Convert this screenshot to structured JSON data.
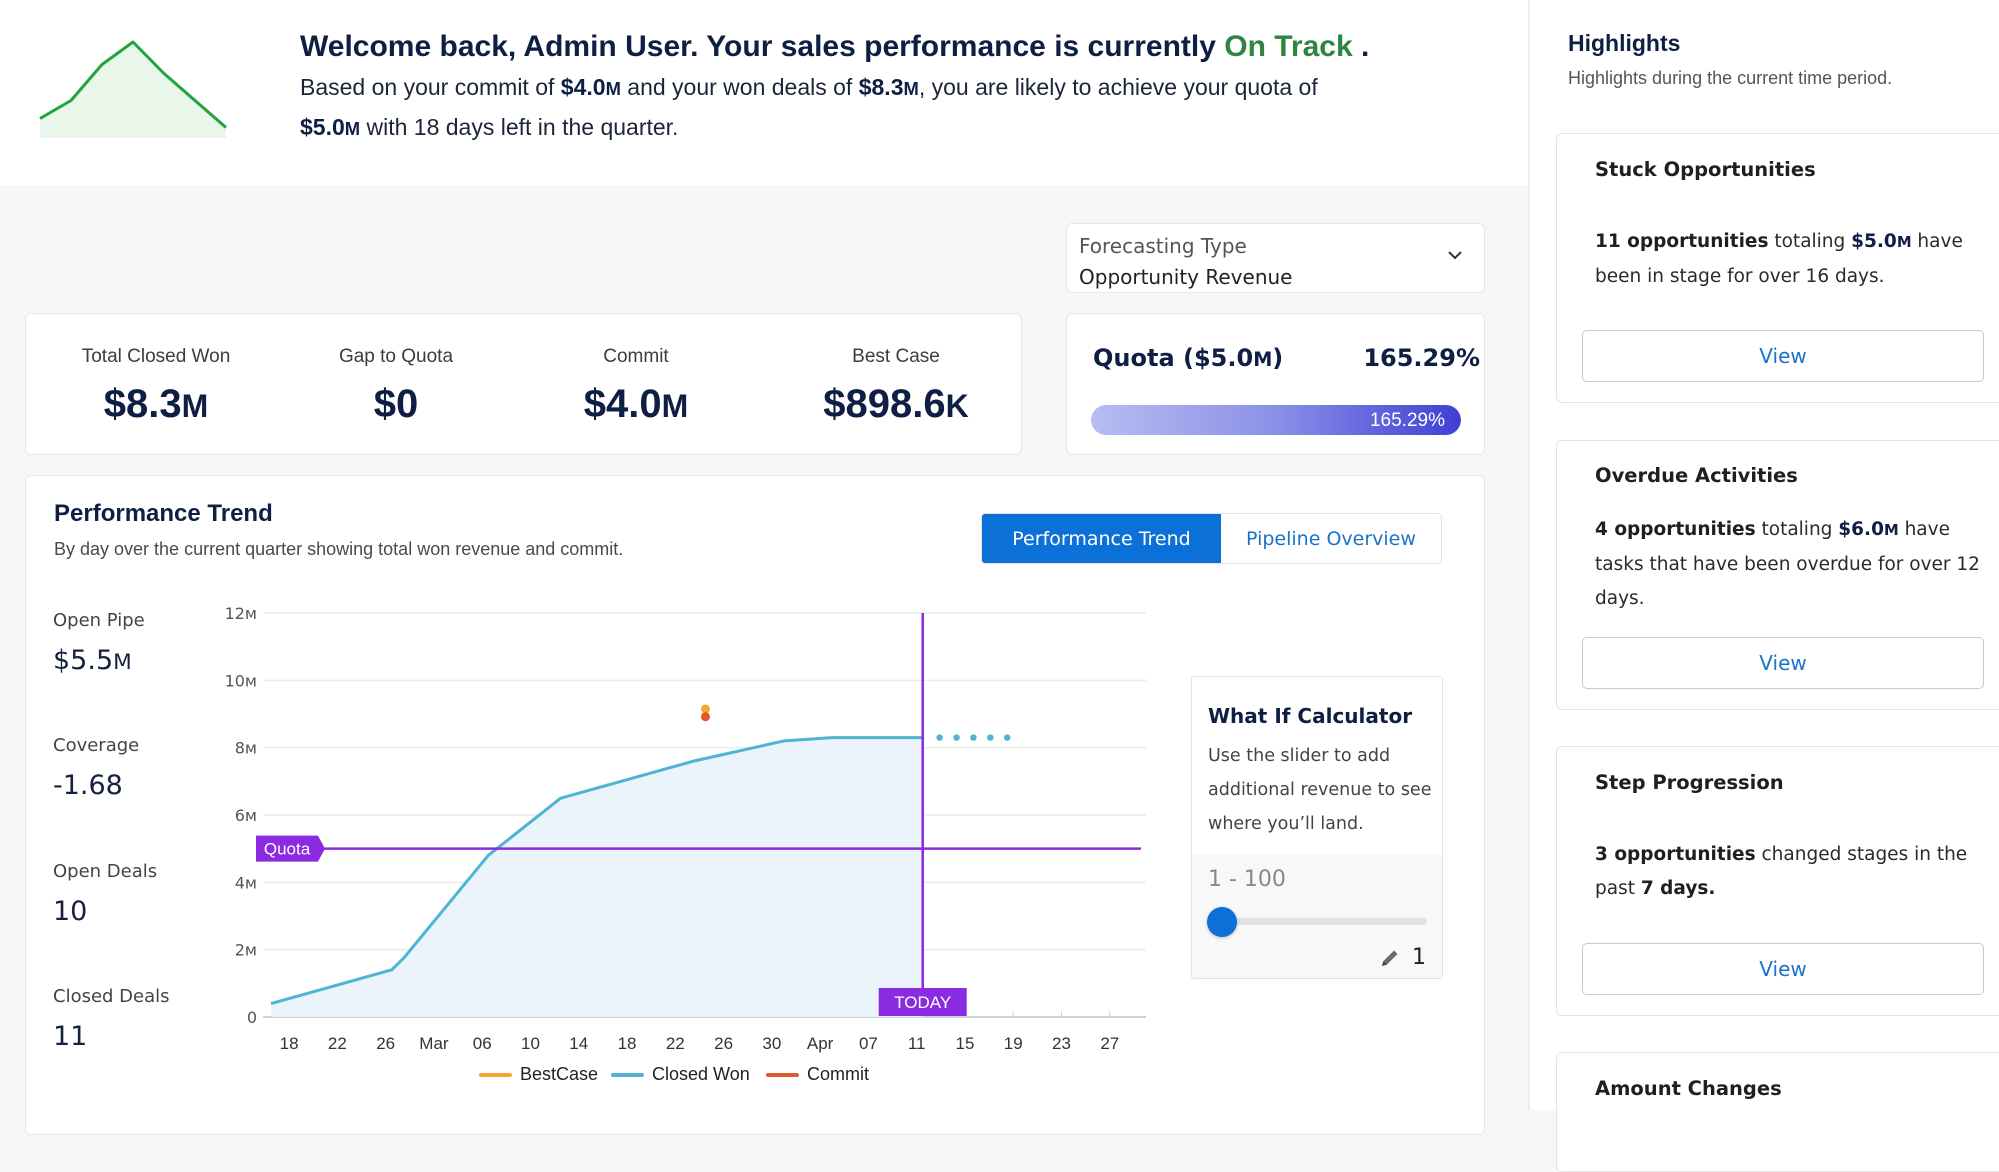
{
  "welcome": {
    "headline_prefix": "Welcome back, Admin User. Your sales performance is currently ",
    "status": "On Track",
    "headline_suffix": " .",
    "line1_a": "Based on your commit of ",
    "line1_commit": "$4.0",
    "line1_b": " and your won deals of ",
    "line1_won": "$8.3",
    "line1_c": ", you are likely to achieve your quota of",
    "line2_quota": "$5.0",
    "line2_rest": " with 18 days left in the quarter.",
    "unit_m": "M",
    "sparkline": [
      3,
      7,
      15,
      20,
      13,
      7,
      1
    ],
    "sparkline_color": "#22a33c"
  },
  "forecast": {
    "label": "Forecasting Type",
    "value": "Opportunity Revenue"
  },
  "stats": [
    {
      "label": "Total Closed Won",
      "value": "$8.3",
      "unit": "M"
    },
    {
      "label": "Gap to Quota",
      "value": "$0",
      "unit": ""
    },
    {
      "label": "Commit",
      "value": "$4.0",
      "unit": "M"
    },
    {
      "label": "Best Case",
      "value": "$898.6",
      "unit": "K"
    }
  ],
  "quota": {
    "label": "Quota ($5.0",
    "label_unit": "M",
    "label_end": ")",
    "percent_text": "165.29%",
    "percent_value": 165.29,
    "bar_fill_fraction": 1.0
  },
  "performance": {
    "title": "Performance Trend",
    "subtitle": "By day over the current quarter showing total won revenue and commit.",
    "tabs": [
      {
        "label": "Performance Trend",
        "active": true
      },
      {
        "label": "Pipeline Overview",
        "active": false
      }
    ],
    "side_metrics": [
      {
        "label": "Open Pipe",
        "value": "$5.5",
        "unit": "M"
      },
      {
        "label": "Coverage",
        "value": "-1.68",
        "unit": ""
      },
      {
        "label": "Open Deals",
        "value": "10",
        "unit": ""
      },
      {
        "label": "Closed Deals",
        "value": "11",
        "unit": ""
      }
    ]
  },
  "chart_data": {
    "type": "area",
    "title": "Performance Trend",
    "xlabel": "",
    "ylabel": "",
    "x_tick_labels": [
      "18",
      "22",
      "26",
      "Mar",
      "06",
      "10",
      "14",
      "18",
      "22",
      "26",
      "30",
      "Apr",
      "07",
      "11",
      "15",
      "19",
      "23",
      "27"
    ],
    "x_range_days": [
      -1.5,
      71
    ],
    "y_tick_labels": [
      "0",
      "2M",
      "4M",
      "6M",
      "8M",
      "10M",
      "12M"
    ],
    "ylim": [
      0,
      12000000
    ],
    "grid": true,
    "legend_position": "bottom-center",
    "series": [
      {
        "name": "Closed Won",
        "color": "#4fb3d4",
        "points_day_value": [
          [
            -1.5,
            0.4
          ],
          [
            8.5,
            1.4
          ],
          [
            9.5,
            1.75
          ],
          [
            16.5,
            4.8
          ],
          [
            22.5,
            6.5
          ],
          [
            33.5,
            7.6
          ],
          [
            41,
            8.2
          ],
          [
            45,
            8.3
          ],
          [
            52.5,
            8.3
          ]
        ],
        "projected_points_day_value": [
          [
            52.5,
            8.3
          ],
          [
            56,
            8.3
          ],
          [
            59.5,
            8.3
          ]
        ]
      },
      {
        "name": "BestCase",
        "color": "#f5a631",
        "points_day_value": [
          [
            34.5,
            9.15
          ]
        ]
      },
      {
        "name": "Commit",
        "color": "#dd5a2b",
        "points_day_value": [
          [
            34.5,
            8.92
          ]
        ]
      }
    ],
    "value_unit": "M",
    "quota_line": {
      "label": "Quota",
      "value": 5.0,
      "color": "#8a2be2"
    },
    "today_marker": {
      "label": "TODAY",
      "day": 52.5,
      "color": "#8a2be2"
    },
    "legend": [
      {
        "name": "BestCase",
        "color": "#f5a631"
      },
      {
        "name": "Closed Won",
        "color": "#4fb3d4"
      },
      {
        "name": "Commit",
        "color": "#dd5a2b"
      }
    ]
  },
  "whatif": {
    "title": "What If Calculator",
    "description": "Use the slider to add additional revenue to see where you’ll land.",
    "range_label": "1 - 100",
    "slider_min": 1,
    "slider_max": 100,
    "slider_value": 1,
    "value_text": "1"
  },
  "highlights": {
    "title": "Highlights",
    "subtitle": "Highlights during the current time period.",
    "view_label": "View",
    "cards": [
      {
        "title": "Stuck Opportunities",
        "count": "11 opportunities",
        "mid": " totaling ",
        "amount": "$5.0",
        "amount_unit": "M",
        "rest": " have been in stage for over 16 days."
      },
      {
        "title": "Overdue Activities",
        "count": "4 opportunities",
        "mid": " totaling ",
        "amount": "$6.0",
        "amount_unit": "M",
        "rest": " have tasks that have been overdue for over 12 days."
      },
      {
        "title": "Step Progression",
        "count": "3 opportunities",
        "mid": " changed stages in the past ",
        "amount_bold": "7 days.",
        "rest": ""
      },
      {
        "title": "Amount Changes"
      }
    ]
  }
}
